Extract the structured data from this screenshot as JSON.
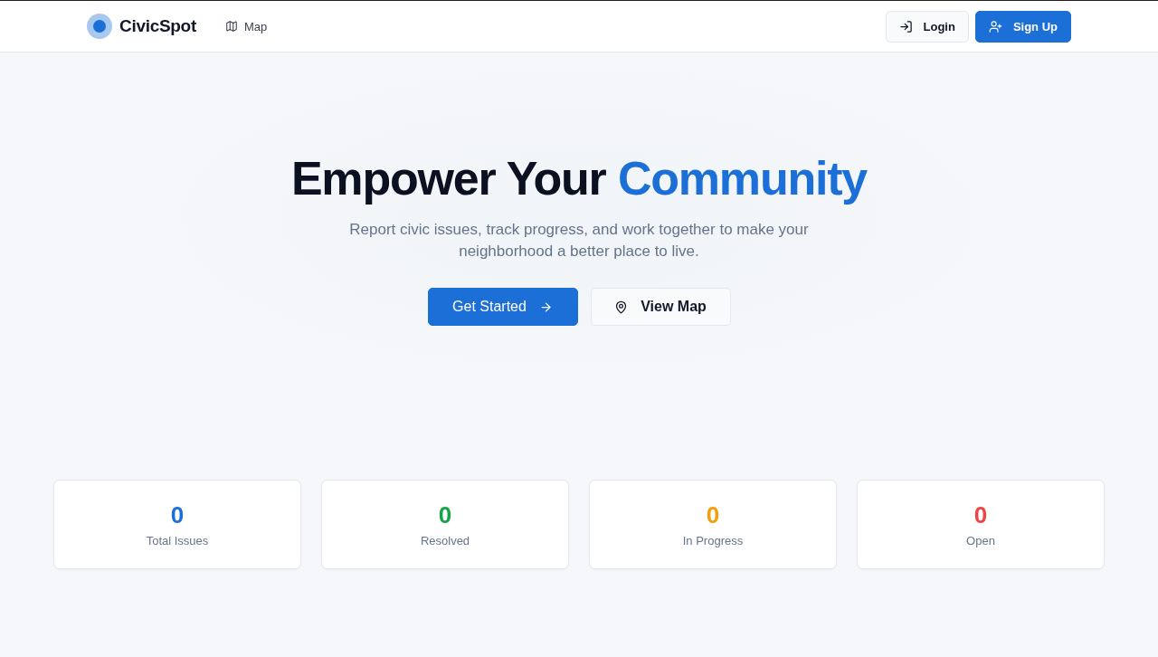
{
  "header": {
    "brand": "CivicSpot",
    "nav": [
      {
        "label": "Map"
      }
    ],
    "actions": [
      {
        "label": "Login",
        "kind": "secondary"
      },
      {
        "label": "Sign Up",
        "kind": "primary"
      }
    ]
  },
  "hero": {
    "title": "Empower Your",
    "title_highlight": "Community",
    "subtitle": "Report civic issues, track progress, and work together to make your neighborhood a better place to live.",
    "buttons": [
      {
        "label": "Get Started",
        "kind": "primary"
      },
      {
        "label": "View Map",
        "kind": "secondary"
      }
    ]
  },
  "stats": [
    {
      "value": "0",
      "label": "Total Issues",
      "color": "#1c6fd6"
    },
    {
      "value": "0",
      "label": "Resolved",
      "color": "#16a34a"
    },
    {
      "value": "0",
      "label": "In Progress",
      "color": "#f59e0b"
    },
    {
      "value": "0",
      "label": "Open",
      "color": "#ef4444"
    }
  ]
}
